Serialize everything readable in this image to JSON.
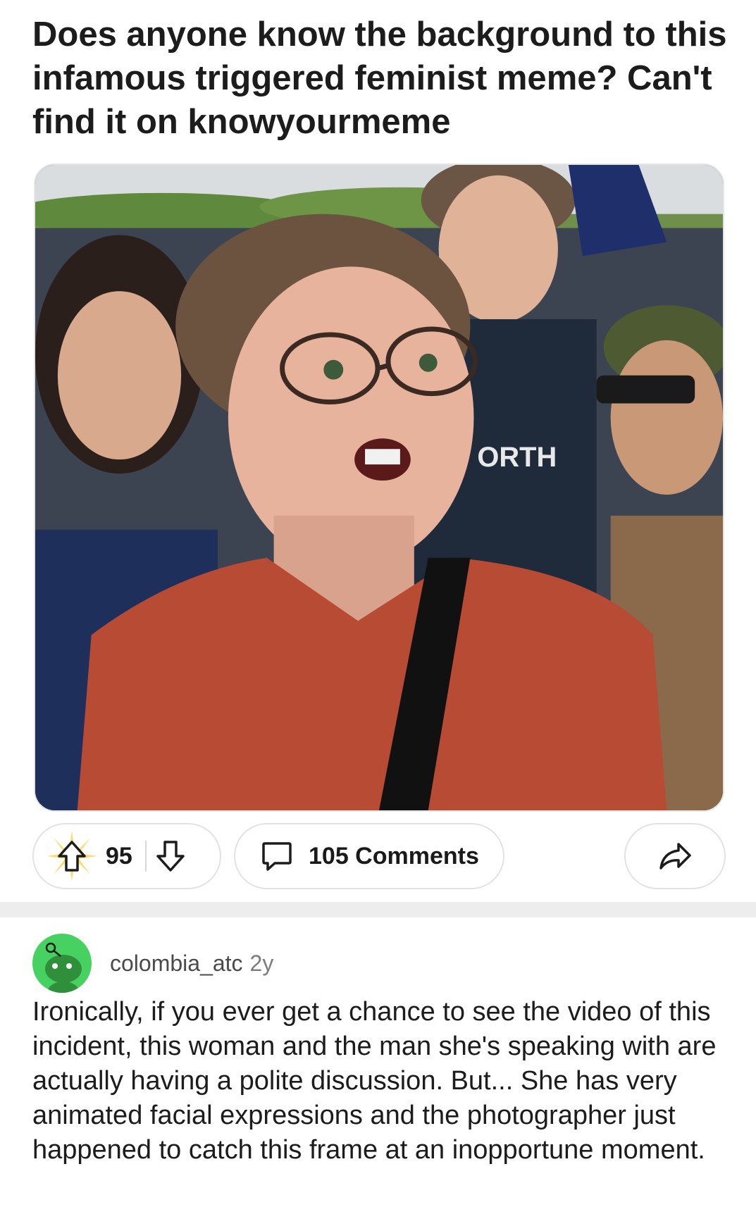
{
  "post": {
    "title": "Does anyone know the background to this infamous triggered feminist meme? Can't find it on knowyourmeme",
    "image": {
      "description_icon": "post-photo",
      "shirt_text": "ORTH"
    },
    "actions": {
      "score": "95",
      "comments": "105 Comments"
    }
  },
  "comment": {
    "username": "colombia_atc",
    "age": "2y",
    "body": "Ironically, if you ever get a chance to see the video of this incident, this woman and the man she's speaking with are actually having a polite discussion.  But... She has very animated facial expressions and the photographer just happened to catch this frame at an inopportune moment."
  },
  "colors": {
    "upvote_burst": "#ffd24a",
    "avatar_bg": "#46d160",
    "divider": "#ededed"
  }
}
